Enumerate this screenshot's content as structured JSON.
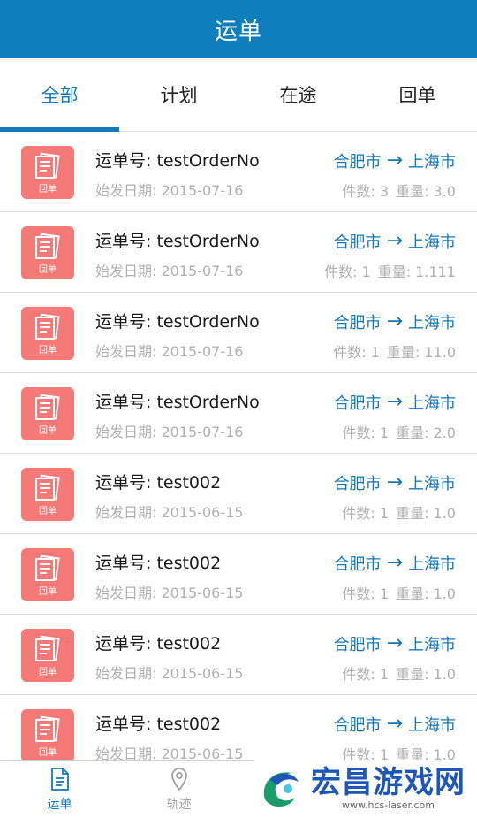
{
  "header": {
    "title": "运单"
  },
  "tabs": [
    {
      "label": "全部",
      "active": true
    },
    {
      "label": "计划",
      "active": false
    },
    {
      "label": "在途",
      "active": false
    },
    {
      "label": "回单",
      "active": false
    }
  ],
  "orders": [
    {
      "order_no": "运单号: testOrderNo",
      "date": "始发日期:  2015-07-16",
      "from": "合肥市",
      "to": "上海市",
      "pieces": "件数: 3",
      "weight": "重量: 3.0",
      "icon_label": "回单"
    },
    {
      "order_no": "运单号: testOrderNo",
      "date": "始发日期:  2015-07-16",
      "from": "合肥市",
      "to": "上海市",
      "pieces": "件数: 1",
      "weight": "重量: 1.111",
      "icon_label": "回单"
    },
    {
      "order_no": "运单号: testOrderNo",
      "date": "始发日期:  2015-07-16",
      "from": "合肥市",
      "to": "上海市",
      "pieces": "件数: 1",
      "weight": "重量: 11.0",
      "icon_label": "回单"
    },
    {
      "order_no": "运单号: testOrderNo",
      "date": "始发日期:  2015-07-16",
      "from": "合肥市",
      "to": "上海市",
      "pieces": "件数: 1",
      "weight": "重量: 2.0",
      "icon_label": "回单"
    },
    {
      "order_no": "运单号: test002",
      "date": "始发日期:  2015-06-15",
      "from": "合肥市",
      "to": "上海市",
      "pieces": "件数: 1",
      "weight": "重量: 1.0",
      "icon_label": "回单"
    },
    {
      "order_no": "运单号: test002",
      "date": "始发日期:  2015-06-15",
      "from": "合肥市",
      "to": "上海市",
      "pieces": "件数: 1",
      "weight": "重量: 1.0",
      "icon_label": "回单"
    },
    {
      "order_no": "运单号: test002",
      "date": "始发日期:  2015-06-15",
      "from": "合肥市",
      "to": "上海市",
      "pieces": "件数: 1",
      "weight": "重量: 1.0",
      "icon_label": "回单"
    },
    {
      "order_no": "运单号: test002",
      "date": "始发日期:  2015-06-15",
      "from": "合肥市",
      "to": "上海市",
      "pieces": "件数: 1",
      "weight": "重量: 1.0",
      "icon_label": "回单"
    }
  ],
  "route_arrow": "→",
  "bottom_nav": [
    {
      "label": "运单",
      "icon": "document-icon",
      "active": true
    },
    {
      "label": "轨迹",
      "icon": "location-pin-icon",
      "active": false
    }
  ],
  "watermark": {
    "title": "宏昌游戏网",
    "url": "www.hcs-laser.com"
  },
  "colors": {
    "primary": "#0e7fbc",
    "accent": "#1479ba",
    "icon_bg": "#f47977",
    "muted": "#b0b0b0"
  }
}
